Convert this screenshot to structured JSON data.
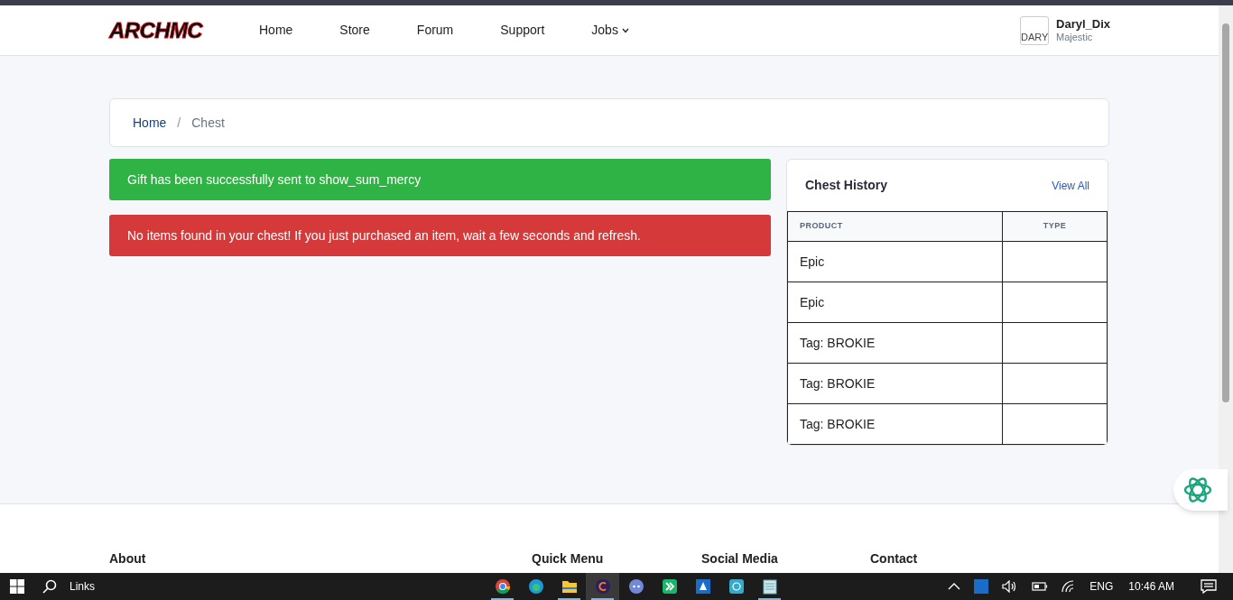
{
  "header": {
    "logo": "ARCHMC",
    "nav": [
      {
        "label": "Home",
        "dropdown": false
      },
      {
        "label": "Store",
        "dropdown": false
      },
      {
        "label": "Forum",
        "dropdown": false
      },
      {
        "label": "Support",
        "dropdown": false
      },
      {
        "label": "Jobs",
        "dropdown": true
      }
    ],
    "user": {
      "avatar_alt": "DARY",
      "name": "Daryl_Dix",
      "rank": "Majestic"
    }
  },
  "breadcrumb_separator": "/",
  "breadcrumb": [
    {
      "label": "Home",
      "link": true
    },
    {
      "label": "Chest",
      "link": false
    }
  ],
  "alerts": [
    {
      "kind": "success",
      "text": "Gift has been successfully sent to show_sum_mercy"
    },
    {
      "kind": "danger",
      "text": "No items found in your chest! If you just purchased an item, wait a few seconds and refresh."
    }
  ],
  "chest_history": {
    "title": "Chest History",
    "view_all": "View All",
    "columns": [
      "PRODUCT",
      "TYPE"
    ],
    "rows": [
      {
        "product": "Epic"
      },
      {
        "product": "Epic"
      },
      {
        "product": "Tag: BROKIE"
      },
      {
        "product": "Tag: BROKIE"
      },
      {
        "product": "Tag: BROKIE"
      }
    ]
  },
  "footer": {
    "headings": [
      "About",
      "Quick Menu",
      "Social Media",
      "Contact"
    ]
  },
  "taskbar": {
    "search_label": "Links",
    "apps": [
      {
        "kind": "chrome",
        "running": true,
        "selected": false
      },
      {
        "kind": "edge",
        "running": false,
        "selected": false
      },
      {
        "kind": "files",
        "running": true,
        "selected": false
      },
      {
        "kind": "c",
        "running": true,
        "selected": true
      },
      {
        "kind": "discord",
        "running": false,
        "selected": false
      },
      {
        "kind": "green",
        "running": false,
        "selected": false
      },
      {
        "kind": "blue",
        "running": false,
        "selected": false
      },
      {
        "kind": "cyan",
        "running": false,
        "selected": false
      },
      {
        "kind": "notepad",
        "running": true,
        "selected": false
      }
    ],
    "language": "ENG",
    "time": "10:46 AM"
  }
}
